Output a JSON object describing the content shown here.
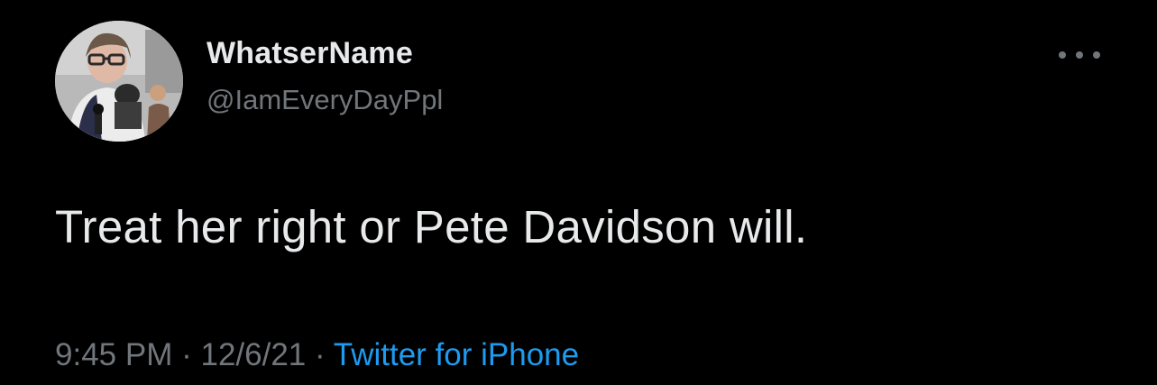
{
  "tweet": {
    "author": {
      "display_name": "WhatserName",
      "handle": "@IamEveryDayPpl"
    },
    "text": "Treat her right or Pete Davidson will.",
    "meta": {
      "time": "9:45 PM",
      "separator": "·",
      "date": "12/6/21",
      "source": "Twitter for iPhone"
    }
  },
  "icons": {
    "more": "more-horizontal-icon"
  },
  "colors": {
    "background": "#000000",
    "primary_text": "#e7e9ea",
    "secondary_text": "#71767b",
    "link": "#1d9bf0"
  }
}
